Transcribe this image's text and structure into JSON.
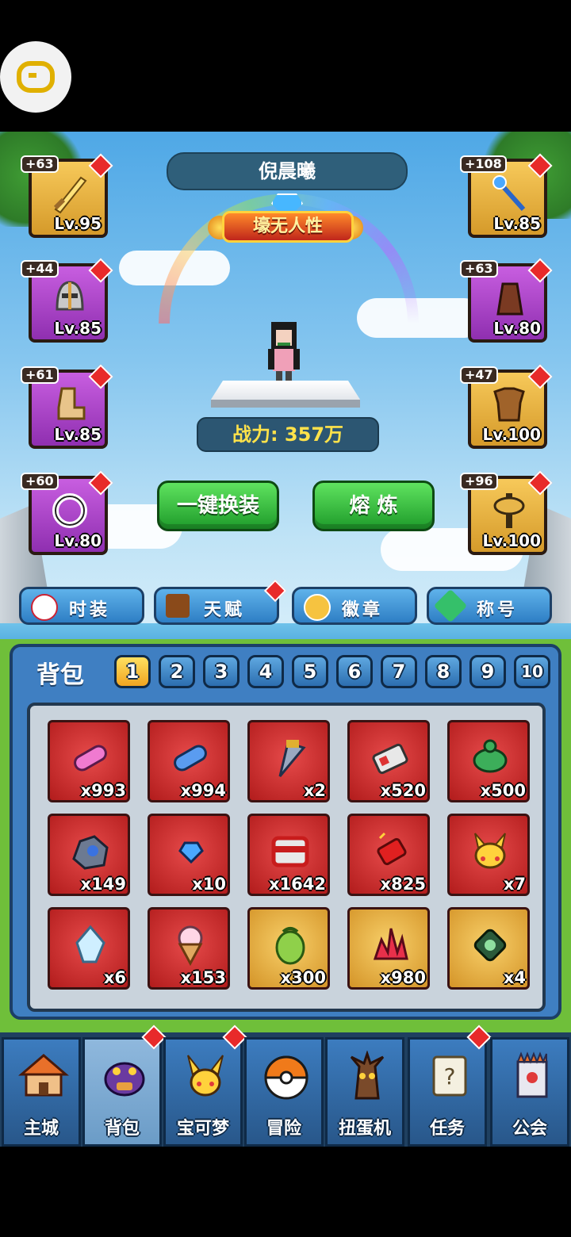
{
  "floating_button": {
    "icon": "gamepad-icon"
  },
  "player": {
    "name": "倪晨曦",
    "title": "壕无人性",
    "power_label": "战力: 357万"
  },
  "equipment_left": [
    {
      "plus": "+63",
      "level": "Lv.95",
      "frame": "gold",
      "icon": "sword-icon"
    },
    {
      "plus": "+44",
      "level": "Lv.85",
      "frame": "purple",
      "icon": "helmet-icon"
    },
    {
      "plus": "+61",
      "level": "Lv.85",
      "frame": "purple",
      "icon": "boots-icon"
    },
    {
      "plus": "+60",
      "level": "Lv.80",
      "frame": "purple",
      "icon": "ring-icon"
    }
  ],
  "equipment_right": [
    {
      "plus": "+108",
      "level": "Lv.85",
      "frame": "gold",
      "icon": "staff-icon"
    },
    {
      "plus": "+63",
      "level": "Lv.80",
      "frame": "purple",
      "icon": "hood-icon"
    },
    {
      "plus": "+47",
      "level": "Lv.100",
      "frame": "gold",
      "icon": "armor-icon"
    },
    {
      "plus": "+96",
      "level": "Lv.100",
      "frame": "gold",
      "icon": "amulet-icon"
    }
  ],
  "actions": {
    "equip_all": "一键换装",
    "smelt": "熔 炼"
  },
  "tabs": [
    {
      "label": "时装",
      "icon": "fashion-icon"
    },
    {
      "label": "天赋",
      "icon": "talent-book-icon"
    },
    {
      "label": "徽章",
      "icon": "badge-icon"
    },
    {
      "label": "称号",
      "icon": "title-gem-icon"
    }
  ],
  "backpack": {
    "label": "背包",
    "pages": [
      "1",
      "2",
      "3",
      "4",
      "5",
      "6",
      "7",
      "8",
      "9",
      "10"
    ],
    "active_page": "1",
    "items": [
      {
        "qty": "x993",
        "frame": "red",
        "icon": "pink-capsule-icon"
      },
      {
        "qty": "x994",
        "frame": "red",
        "icon": "blue-capsule-icon"
      },
      {
        "qty": "x2",
        "frame": "red",
        "icon": "drill-icon"
      },
      {
        "qty": "x520",
        "frame": "red",
        "icon": "device-icon"
      },
      {
        "qty": "x500",
        "frame": "red",
        "icon": "turtle-icon"
      },
      {
        "qty": "x149",
        "frame": "red",
        "icon": "ore-icon"
      },
      {
        "qty": "x10",
        "frame": "red",
        "icon": "blue-gem-icon"
      },
      {
        "qty": "x1642",
        "frame": "red",
        "icon": "chest-icon"
      },
      {
        "qty": "x825",
        "frame": "red",
        "icon": "firecracker-icon"
      },
      {
        "qty": "x7",
        "frame": "red",
        "icon": "pikachu-icon"
      },
      {
        "qty": "x6",
        "frame": "red",
        "icon": "crystal-icon"
      },
      {
        "qty": "x153",
        "frame": "red",
        "icon": "ice-cream-icon"
      },
      {
        "qty": "x300",
        "frame": "gold",
        "icon": "green-egg-icon"
      },
      {
        "qty": "x980",
        "frame": "gold",
        "icon": "red-crystal-icon"
      },
      {
        "qty": "x4",
        "frame": "gold",
        "icon": "green-token-icon"
      }
    ]
  },
  "nav": [
    {
      "label": "主城",
      "icon": "house-icon",
      "active": false
    },
    {
      "label": "背包",
      "icon": "backpack-icon",
      "active": true
    },
    {
      "label": "宝可梦",
      "icon": "pikachu-icon",
      "active": false
    },
    {
      "label": "冒险",
      "icon": "pokeball-icon",
      "active": false
    },
    {
      "label": "扭蛋机",
      "icon": "tree-icon",
      "active": false
    },
    {
      "label": "任务",
      "icon": "scroll-icon",
      "active": false
    },
    {
      "label": "公会",
      "icon": "guild-icon",
      "active": false
    }
  ],
  "colors": {
    "alert_dot": "#e82a2a",
    "gold_frame": "#f1b93e",
    "purple_frame": "#b04ad0",
    "red_frame": "#d63030",
    "green_button": "#2fb83c"
  }
}
